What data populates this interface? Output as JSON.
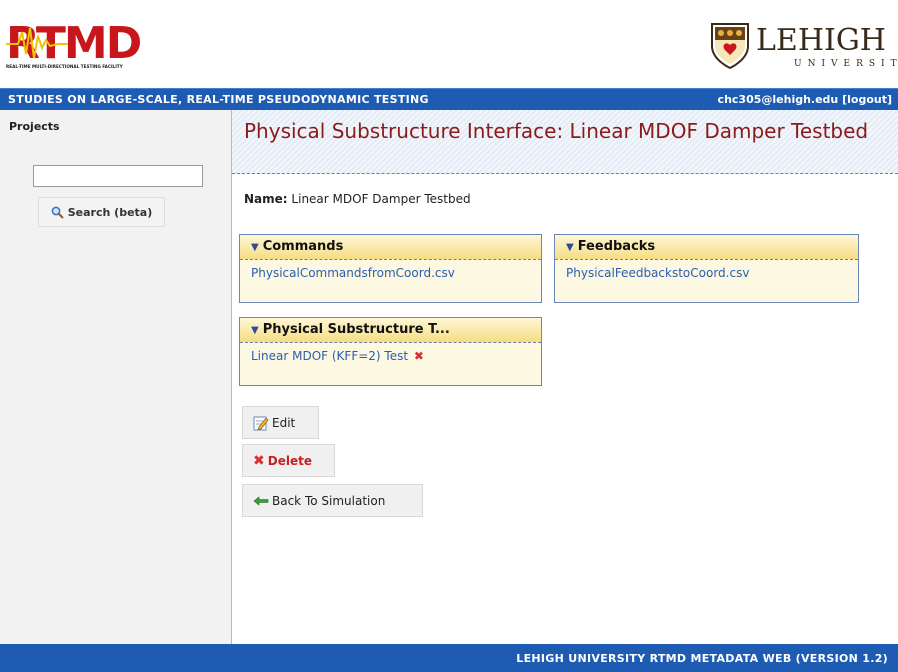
{
  "header": {
    "logo_text": "RTMD",
    "logo_sub": "REAL-TIME MULTI-DIRECTIONAL TESTING FACILITY",
    "univ_name": "LEHIGH",
    "univ_sub": "UNIVERSITY"
  },
  "topbar": {
    "tagline": "STUDIES ON LARGE-SCALE, REAL-TIME PSEUDODYNAMIC TESTING",
    "user": "chc305@lehigh.edu [logout]"
  },
  "sidebar": {
    "title": "Projects",
    "search_value": "",
    "search_label": "Search (beta)"
  },
  "main": {
    "title": "Physical Substructure Interface: Linear MDOF Damper Testbed",
    "name_label": "Name:",
    "name_value": "Linear MDOF Damper Testbed",
    "panels": [
      {
        "title": "Commands",
        "item": "PhysicalCommandsfromCoord.csv"
      },
      {
        "title": "Feedbacks",
        "item": "PhysicalFeedbackstoCoord.csv"
      },
      {
        "title": "Physical Substructure T...",
        "item": "Linear MDOF (KFF=2) Test"
      }
    ],
    "buttons": {
      "edit": "Edit",
      "delete": "Delete",
      "back": "Back To Simulation"
    }
  },
  "footer": {
    "text": "LEHIGH UNIVERSITY RTMD METADATA WEB (VERSION 1.2)"
  },
  "colors": {
    "bar_blue": "#1e5cb3",
    "title_red": "#8b1a1a",
    "link_blue": "#2a5db0",
    "panel_yellow": "#fdf8e1",
    "lehigh_brown": "#5a3a1a"
  }
}
